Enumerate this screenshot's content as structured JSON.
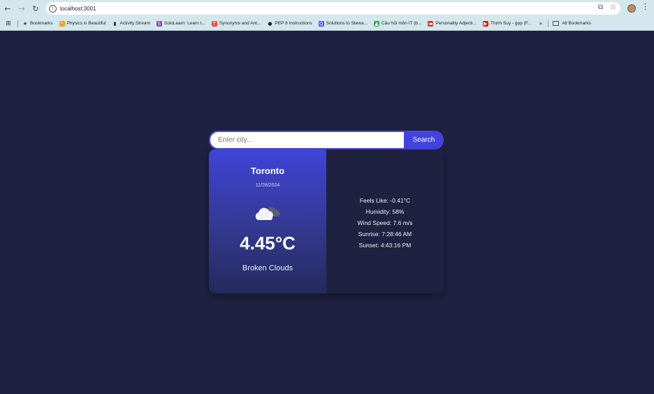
{
  "browser": {
    "url": "localhost:3001",
    "bookmarks": [
      {
        "label": "Bookmarks",
        "icon": "star-icon",
        "color": "#333333",
        "glyph": "★"
      },
      {
        "label": "Physics is Beautiful",
        "icon": "flame-icon",
        "color": "#f39c12",
        "glyph": "ϟ"
      },
      {
        "label": "Activity Stream",
        "icon": "bars-icon",
        "color": "#222222",
        "glyph": "▮"
      },
      {
        "label": "SoloLearn: Learn t...",
        "icon": "sololearn-icon",
        "color": "#8e44ad",
        "glyph": "S"
      },
      {
        "label": "Synonyms and Ant...",
        "icon": "thesaurus-icon",
        "color": "#e74c3c",
        "glyph": "T"
      },
      {
        "label": "PEP 8 Instructions",
        "icon": "github-icon",
        "color": "#222222",
        "glyph": "●"
      },
      {
        "label": "Solutions to Stewa...",
        "icon": "quizlet-icon",
        "color": "#4255ff",
        "glyph": "Q"
      },
      {
        "label": "Câu hỏi môn IT (b...",
        "icon": "drive-icon",
        "color": "#34a853",
        "glyph": "▲"
      },
      {
        "label": "Personality Adjecti...",
        "icon": "flag-icon",
        "color": "#c0392b",
        "glyph": "▬"
      },
      {
        "label": "Thịnh Suy - gọp (F...",
        "icon": "youtube-icon",
        "color": "#ff0000",
        "glyph": "▶"
      }
    ],
    "all_bookmarks": "All Bookmarks"
  },
  "search": {
    "placeholder": "Enter city...",
    "button_label": "Search"
  },
  "weather": {
    "city": "Toronto",
    "date": "11/28/2024",
    "icon": "broken-clouds-icon",
    "temperature": "4.45°C",
    "description": "Broken Clouds",
    "details": {
      "feels_like": "Feels Like: -0.41°C",
      "humidity": "Humidity: 58%",
      "wind_speed": "Wind Speed: 7.6 m/s",
      "sunrise": "Sunrise: 7:28:46 AM",
      "sunset": "Sunset: 4:43:16 PM"
    }
  },
  "colors": {
    "background": "#1f2140",
    "accent": "#4343e0"
  }
}
